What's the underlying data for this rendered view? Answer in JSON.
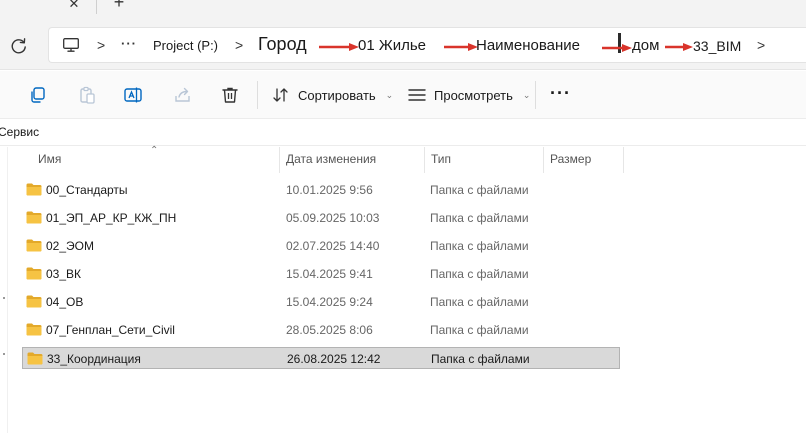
{
  "window": {
    "tab_close_glyph": "✕",
    "tab_new_glyph": "+"
  },
  "address": {
    "root_icon": "pc-icon",
    "overflow_glyph": "···",
    "chevron": ">",
    "segments": [
      "Project (P:)",
      "Город",
      "01 Жилье",
      "Наименование",
      "дом",
      "33_BIM"
    ]
  },
  "toolbar": {
    "icons": [
      "copy-icon",
      "paste-icon",
      "rename-icon",
      "share-icon",
      "delete-icon"
    ],
    "sort_label": "Сортировать",
    "view_label": "Просмотреть",
    "more_label": "···",
    "caret": "⌄"
  },
  "service": {
    "label": "Сервис"
  },
  "list": {
    "columns": {
      "name": "Имя",
      "date": "Дата изменения",
      "type": "Тип",
      "size": "Размер"
    },
    "sort_glyph": "⌃",
    "rows": [
      {
        "name": "00_Стандарты",
        "date": "10.01.2025 9:56",
        "type": "Папка с файлами"
      },
      {
        "name": "01_ЭП_АР_КР_КЖ_ПН",
        "date": "05.09.2025 10:03",
        "type": "Папка с файлами"
      },
      {
        "name": "02_ЭОМ",
        "date": "02.07.2025 14:40",
        "type": "Папка с файлами"
      },
      {
        "name": "03_ВК",
        "date": "15.04.2025 9:41",
        "type": "Папка с файлами"
      },
      {
        "name": "04_ОВ",
        "date": "15.04.2025 9:24",
        "type": "Папка с файлами"
      },
      {
        "name": "07_Генплан_Сети_Civil",
        "date": "28.05.2025 8:06",
        "type": "Папка с файлами"
      },
      {
        "name": "33_Координация",
        "date": "26.08.2025 12:42",
        "type": "Папка с файлами"
      }
    ],
    "selected_row": 6
  },
  "colors": {
    "folder": "#f6c343",
    "folder_dark": "#e3a92a",
    "annotation_arrow": "#d9342b",
    "accent": "#0067c0",
    "selection": "#d9d9d9"
  }
}
